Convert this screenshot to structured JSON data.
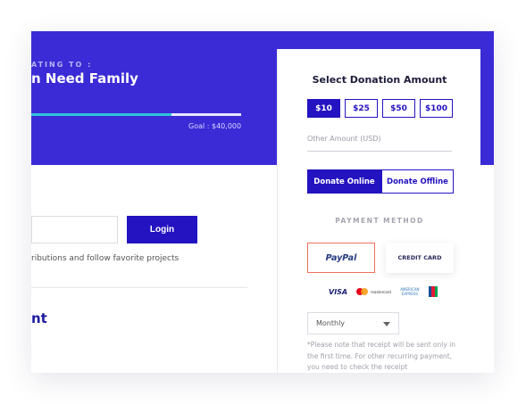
{
  "campaign": {
    "donating_to_label": "ATING TO :",
    "title": "n Need Family",
    "progress_fraction": 0.67,
    "goal_text": "Goal : $40,000",
    "colors": {
      "hero_bg": "#3b2bd6",
      "progress": "#30c5d9",
      "accent": "#2413c0"
    }
  },
  "login": {
    "button_label": "Login",
    "helper_text": "ributions and follow favorite projects",
    "section_heading": "nt"
  },
  "donation": {
    "title": "Select Donation Amount",
    "amounts": [
      "$10",
      "$25",
      "$50",
      "$100"
    ],
    "selected_amount": "$10",
    "other_amount_placeholder": "Other Amount (USD)",
    "modes": [
      "Donate Online",
      "Donate Offline"
    ],
    "active_mode": "Donate Online",
    "payment_method_label": "PAYMENT METHOD",
    "payment_options": {
      "paypal": "PayPal",
      "credit_card": "CREDIT CARD"
    },
    "selected_payment": "PayPal",
    "card_logos": {
      "visa": "VISA",
      "mastercard": "mastercard",
      "amex": "AMERICAN EXPRESS",
      "jcb": "jcb-icon"
    },
    "frequency": "Monthly",
    "note": "*Please note that receipt will be sent only in the first time. For other recurring payment, you need to check the receipt"
  }
}
